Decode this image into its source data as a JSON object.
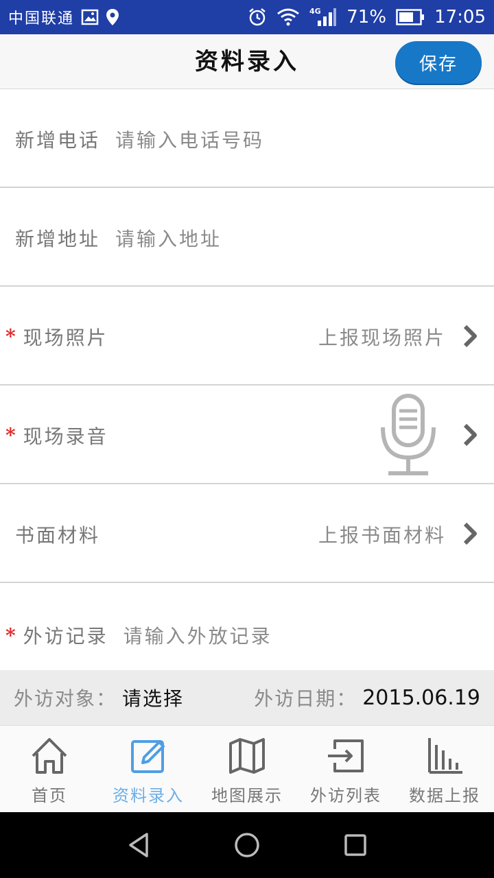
{
  "status_bar": {
    "carrier": "中国联通",
    "network": "4G",
    "battery": "71%",
    "time": "17:05"
  },
  "header": {
    "title": "资料录入",
    "save_label": "保存"
  },
  "form": {
    "phone": {
      "label": "新增电话",
      "placeholder": "请输入电话号码"
    },
    "address": {
      "label": "新增地址",
      "placeholder": "请输入地址"
    },
    "photo": {
      "required_mark": "*",
      "label": "现场照片",
      "action": "上报现场照片"
    },
    "audio": {
      "required_mark": "*",
      "label": "现场录音"
    },
    "documents": {
      "label": "书面材料",
      "action": "上报书面材料"
    },
    "visit_record": {
      "required_mark": "*",
      "label": "外访记录",
      "placeholder": "请输入外放记录"
    }
  },
  "info_bar": {
    "target_label": "外访对象：",
    "target_value": "请选择",
    "date_label": "外访日期：",
    "date_value": "2015.06.19"
  },
  "tabs": [
    {
      "label": "首页",
      "icon": "home-icon",
      "active": false
    },
    {
      "label": "资料录入",
      "icon": "edit-icon",
      "active": true
    },
    {
      "label": "地图展示",
      "icon": "map-icon",
      "active": false
    },
    {
      "label": "外访列表",
      "icon": "exit-list-icon",
      "active": false
    },
    {
      "label": "数据上报",
      "icon": "bar-chart-icon",
      "active": false
    }
  ],
  "colors": {
    "status_bar": "#1f3ea6",
    "accent": "#1878c8",
    "active_tab": "#6aaee8",
    "required": "#e0282a"
  }
}
